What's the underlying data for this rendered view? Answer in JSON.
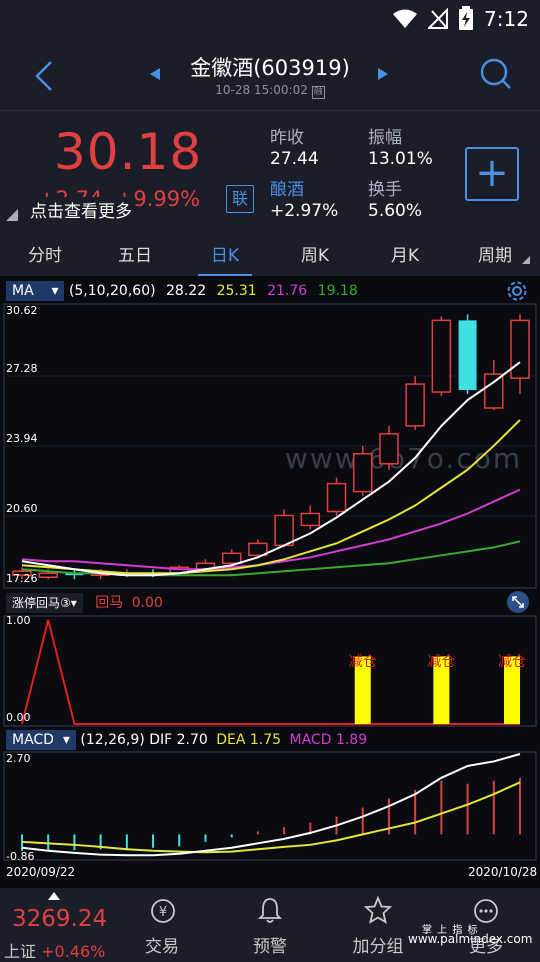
{
  "status_bar": {
    "time": "7:12"
  },
  "header": {
    "stock_title": "金徽酒(603919)",
    "timestamp": "10-28 15:00:02",
    "timestamp_badge": "融"
  },
  "quote": {
    "price": "30.18",
    "change": "+2.74",
    "change_pct": "+9.99%",
    "tooltip": "点击查看更多",
    "link_badge": "联",
    "prev_close_label": "昨收",
    "prev_close": "27.44",
    "amplitude_label": "振幅",
    "amplitude": "13.01%",
    "sector_label": "酿酒",
    "sector_change": "+2.97%",
    "turnover_label": "换手",
    "turnover": "5.60%",
    "add_label": "+"
  },
  "tabs": [
    "分时",
    "五日",
    "日K",
    "周K",
    "月K",
    "周期"
  ],
  "active_tab": "日K",
  "ma_legend": {
    "name": "MA",
    "params": "(5,10,20,60)",
    "ma5": "28.22",
    "ma10": "25.31",
    "ma20": "21.76",
    "ma60": "19.18",
    "colors": {
      "ma5": "#ffffff",
      "ma10": "#e6e63a",
      "ma20": "#d23cd2",
      "ma60": "#3aa832"
    }
  },
  "price_axis": [
    "30.62",
    "27.28",
    "23.94",
    "20.60",
    "17.26"
  ],
  "watermark": "www.6o7o.com",
  "ind_legend": {
    "name": "涨停回马③",
    "label": "回马",
    "value": "0.00"
  },
  "ind_axis": [
    "1.00",
    "0.00"
  ],
  "ind_signals": [
    "减仓",
    "减仓",
    "减仓"
  ],
  "macd_legend": {
    "name": "MACD",
    "params": "(12,26,9)",
    "dif_label": "DIF",
    "dif": "2.70",
    "dea_label": "DEA",
    "dea": "1.75",
    "macd_label": "MACD",
    "macd": "1.89"
  },
  "macd_axis": [
    "2.70",
    "-0.86"
  ],
  "date_axis": [
    "2020/09/22",
    "2020/10/28"
  ],
  "nav": {
    "index_value": "3269.24",
    "index_name": "上证",
    "index_change": "+0.46%",
    "items": [
      "交易",
      "预警",
      "加分组",
      "更多"
    ],
    "watermark_top": "掌 上 指 标",
    "watermark_url": "www.palmindex.com"
  },
  "chart_data": {
    "type": "candlestick",
    "candles": [
      {
        "o": 17.5,
        "c": 17.7,
        "h": 17.9,
        "l": 17.3
      },
      {
        "o": 17.4,
        "c": 17.6,
        "h": 17.8,
        "l": 17.3
      },
      {
        "o": 17.6,
        "c": 17.5,
        "h": 17.8,
        "l": 17.3
      },
      {
        "o": 17.5,
        "c": 17.6,
        "h": 17.8,
        "l": 17.3
      },
      {
        "o": 17.5,
        "c": 17.6,
        "h": 17.8,
        "l": 17.4
      },
      {
        "o": 17.6,
        "c": 17.5,
        "h": 17.8,
        "l": 17.4
      },
      {
        "o": 17.6,
        "c": 17.9,
        "h": 18.0,
        "l": 17.5
      },
      {
        "o": 17.8,
        "c": 18.1,
        "h": 18.3,
        "l": 17.7
      },
      {
        "o": 18.1,
        "c": 18.6,
        "h": 18.8,
        "l": 18.0
      },
      {
        "o": 18.5,
        "c": 19.1,
        "h": 19.3,
        "l": 18.4
      },
      {
        "o": 19.0,
        "c": 20.5,
        "h": 20.8,
        "l": 18.9
      },
      {
        "o": 20.0,
        "c": 20.6,
        "h": 21.0,
        "l": 19.8
      },
      {
        "o": 20.7,
        "c": 22.1,
        "h": 22.4,
        "l": 20.5
      },
      {
        "o": 21.7,
        "c": 23.6,
        "h": 24.0,
        "l": 21.5
      },
      {
        "o": 23.1,
        "c": 24.6,
        "h": 25.0,
        "l": 22.8
      },
      {
        "o": 25.0,
        "c": 27.1,
        "h": 27.5,
        "l": 24.8
      },
      {
        "o": 26.7,
        "c": 30.3,
        "h": 30.5,
        "l": 26.5
      },
      {
        "o": 30.3,
        "c": 26.8,
        "h": 30.6,
        "l": 26.6
      },
      {
        "o": 25.9,
        "c": 27.6,
        "h": 28.3,
        "l": 25.8
      },
      {
        "o": 27.4,
        "c": 30.3,
        "h": 30.6,
        "l": 26.6
      }
    ],
    "ma5": [
      18.2,
      18.0,
      17.8,
      17.6,
      17.5,
      17.5,
      17.6,
      17.8,
      18.0,
      18.4,
      19.0,
      19.6,
      20.4,
      21.3,
      22.2,
      23.4,
      25.0,
      26.3,
      27.2,
      28.2
    ],
    "ma10": [
      18.0,
      17.9,
      17.8,
      17.7,
      17.6,
      17.6,
      17.6,
      17.7,
      17.8,
      18.0,
      18.3,
      18.7,
      19.1,
      19.7,
      20.3,
      21.0,
      21.9,
      22.8,
      24.0,
      25.3
    ],
    "ma20": [
      18.3,
      18.2,
      18.2,
      18.1,
      18.0,
      17.9,
      17.8,
      17.8,
      17.9,
      18.0,
      18.2,
      18.4,
      18.7,
      19.0,
      19.3,
      19.7,
      20.1,
      20.6,
      21.2,
      21.8
    ],
    "ma60": [
      17.8,
      17.7,
      17.6,
      17.6,
      17.5,
      17.5,
      17.5,
      17.5,
      17.5,
      17.6,
      17.7,
      17.8,
      17.9,
      18.0,
      18.1,
      18.3,
      18.5,
      18.7,
      18.9,
      19.2
    ],
    "ylim": [
      17.26,
      30.62
    ],
    "ind_values": [
      0,
      1,
      0,
      0,
      0,
      0,
      0,
      0,
      0,
      0,
      0,
      0,
      0,
      0,
      0,
      0,
      0,
      0,
      0,
      0
    ],
    "ind_signal_bars": [
      13,
      16,
      19
    ],
    "macd_hist": [
      -0.55,
      -0.55,
      -0.53,
      -0.5,
      -0.48,
      -0.45,
      -0.4,
      -0.25,
      -0.1,
      0.1,
      0.25,
      0.4,
      0.6,
      0.9,
      1.2,
      1.5,
      1.8,
      1.7,
      1.8,
      1.9
    ],
    "dif": [
      -0.45,
      -0.55,
      -0.62,
      -0.68,
      -0.7,
      -0.7,
      -0.65,
      -0.55,
      -0.45,
      -0.3,
      -0.15,
      0.05,
      0.3,
      0.6,
      0.95,
      1.35,
      1.9,
      2.3,
      2.45,
      2.7
    ],
    "dea": [
      -0.25,
      -0.3,
      -0.35,
      -0.42,
      -0.5,
      -0.55,
      -0.58,
      -0.6,
      -0.58,
      -0.5,
      -0.42,
      -0.35,
      -0.2,
      0.0,
      0.2,
      0.4,
      0.7,
      1.0,
      1.35,
      1.75
    ],
    "macd_ylim": [
      -0.86,
      2.7
    ]
  }
}
